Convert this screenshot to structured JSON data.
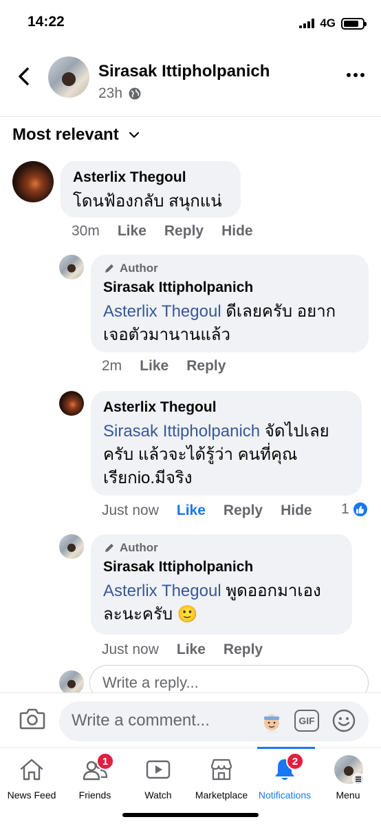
{
  "status": {
    "time": "14:22",
    "network": "4G"
  },
  "header": {
    "name": "Sirasak Ittipholpanich",
    "time": "23h"
  },
  "sort": {
    "label": "Most relevant"
  },
  "comments": [
    {
      "name": "Asterlix Thegoul",
      "text": "โดนฟ้องกลับ สนุกแน่",
      "time": "30m",
      "like": "Like",
      "reply": "Reply",
      "hide": "Hide"
    },
    {
      "author_badge": "Author",
      "name": "Sirasak Ittipholpanich",
      "mention": "Asterlix Thegoul",
      "text": " ดีเลยครับ อยากเจอตัวมานานแล้ว",
      "time": "2m",
      "like": "Like",
      "reply": "Reply"
    },
    {
      "name": "Asterlix Thegoul",
      "mention": "Sirasak Ittipholpanich",
      "text": " จัดไปเลยครับ แล้วจะได้รู้ว่า คนที่คุณเรียกio.มีจริง",
      "time": "Just now",
      "like": "Like",
      "reply": "Reply",
      "hide": "Hide",
      "reaction_count": "1"
    },
    {
      "author_badge": "Author",
      "name": "Sirasak Ittipholpanich",
      "mention": "Asterlix Thegoul",
      "text": " พูดออกมาเองละนะครับ ",
      "emoji": "🙂",
      "time": "Just now",
      "like": "Like",
      "reply": "Reply"
    }
  ],
  "reply_box": {
    "placeholder": "Write a reply..."
  },
  "composer": {
    "placeholder": "Write a comment...",
    "gif": "GIF"
  },
  "tabs": [
    {
      "label": "News Feed",
      "icon": "home-icon"
    },
    {
      "label": "Friends",
      "icon": "friends-icon",
      "badge": "1"
    },
    {
      "label": "Watch",
      "icon": "watch-icon"
    },
    {
      "label": "Marketplace",
      "icon": "marketplace-icon"
    },
    {
      "label": "Notifications",
      "icon": "bell-icon",
      "badge": "2",
      "active": true
    },
    {
      "label": "Menu",
      "icon": "menu-avatar-icon"
    }
  ],
  "colors": {
    "accent": "#1877f2",
    "link": "#385898",
    "bubble": "#f0f2f5",
    "badge": "#e41e3f",
    "muted": "#65676b"
  }
}
